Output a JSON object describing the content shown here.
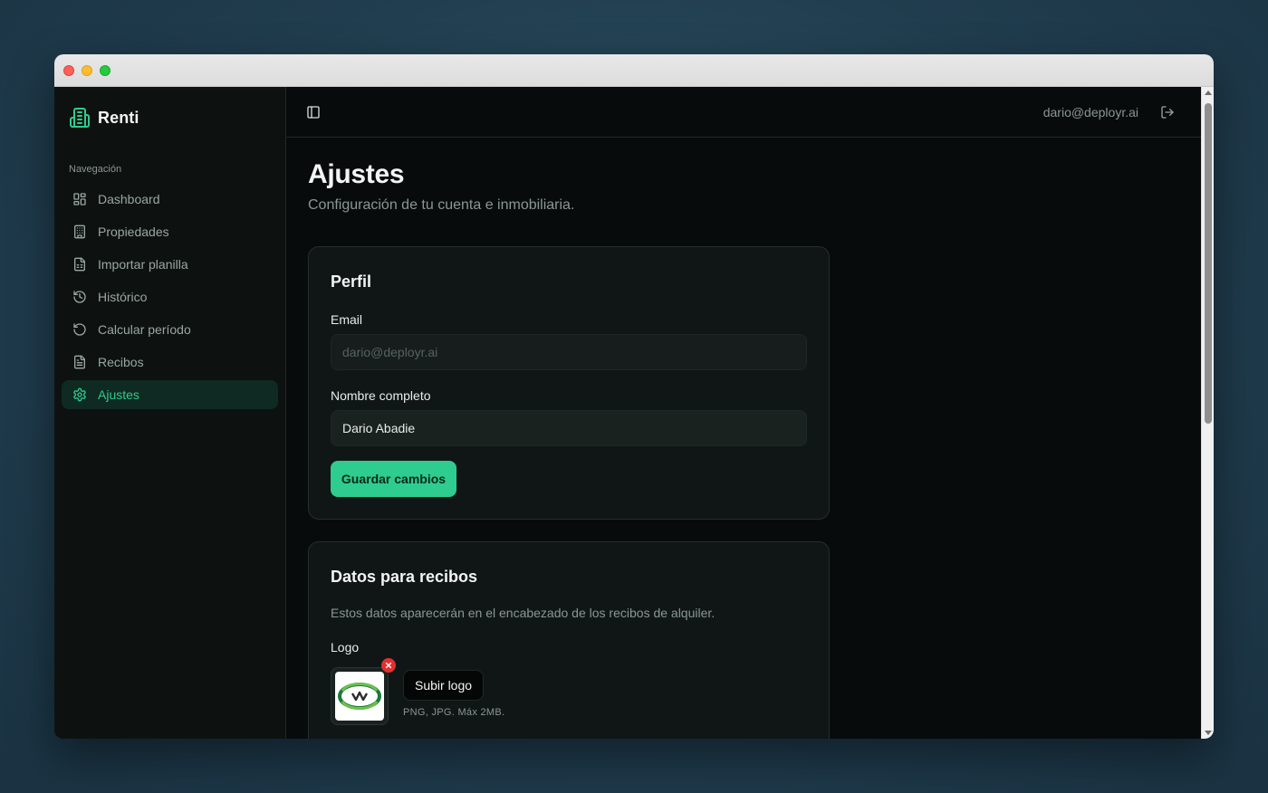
{
  "app": {
    "name": "Renti"
  },
  "colors": {
    "accent": "#2ecc8f",
    "danger": "#e03131",
    "background": "#080b0b"
  },
  "sidebar": {
    "group_label": "Navegación",
    "items": [
      {
        "label": "Dashboard",
        "icon": "dashboard-icon",
        "active": false
      },
      {
        "label": "Propiedades",
        "icon": "building-icon",
        "active": false
      },
      {
        "label": "Importar planilla",
        "icon": "spreadsheet-icon",
        "active": false
      },
      {
        "label": "Histórico",
        "icon": "history-icon",
        "active": false
      },
      {
        "label": "Calcular período",
        "icon": "rotate-icon",
        "active": false
      },
      {
        "label": "Recibos",
        "icon": "receipt-icon",
        "active": false
      },
      {
        "label": "Ajustes",
        "icon": "gear-icon",
        "active": true
      }
    ]
  },
  "header": {
    "user_email": "dario@deployr.ai",
    "logout_icon": "logout-icon",
    "toggle_icon": "sidebar-toggle-icon"
  },
  "page": {
    "title": "Ajustes",
    "subtitle": "Configuración de tu cuenta e inmobiliaria."
  },
  "profile": {
    "title": "Perfil",
    "email_label": "Email",
    "email_placeholder": "dario@deployr.ai",
    "name_label": "Nombre completo",
    "name_value": "Dario Abadie",
    "save_label": "Guardar cambios"
  },
  "receipts": {
    "title": "Datos para recibos",
    "description": "Estos datos aparecerán en el encabezado de los recibos de alquiler.",
    "logo_label": "Logo",
    "upload_label": "Subir logo",
    "upload_hint": "PNG, JPG. Máx 2MB."
  }
}
